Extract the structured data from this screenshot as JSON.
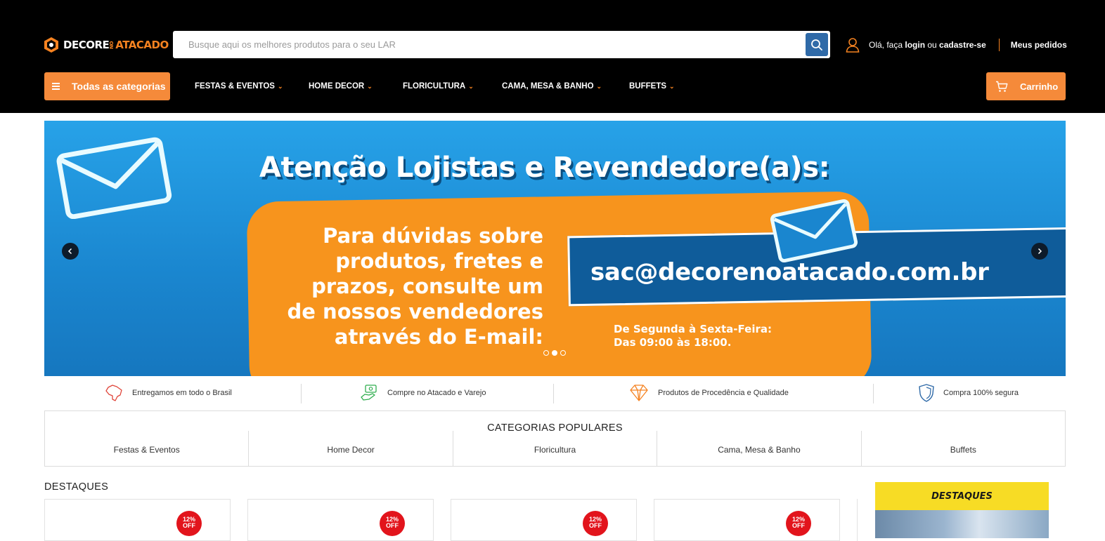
{
  "brand": {
    "logo_part1": "DECORE",
    "logo_part2": "NO",
    "logo_part3": "ATACADO",
    "accent_color": "#f58220",
    "header_bg": "#000000"
  },
  "search": {
    "placeholder": "Busque aqui os melhores produtos para o seu LAR",
    "icon": "search-icon"
  },
  "account": {
    "greeting": "Olá, faça ",
    "login": "login",
    "or": " ou ",
    "signup": "cadastre-se",
    "orders": "Meus pedidos",
    "icon": "user-icon"
  },
  "nav": {
    "all_categories": "Todas as categorias",
    "items": [
      {
        "label": "FESTAS & EVENTOS"
      },
      {
        "label": "HOME DECOR"
      },
      {
        "label": "FLORICULTURA"
      },
      {
        "label": "CAMA, MESA & BANHO"
      },
      {
        "label": "BUFFETS"
      }
    ],
    "cart": "Carrinho"
  },
  "banner": {
    "title": "Atenção Lojistas e Revendedore(a)s:",
    "body_lines": [
      "Para dúvidas sobre",
      "produtos, fretes e",
      "prazos, consulte um",
      "de nossos vendedores",
      "através do E-mail:"
    ],
    "email": "sac@decorenoatacado.com.br",
    "hours_line1": "De Segunda à Sexta-Feira:",
    "hours_line2": "Das 09:00 às 18:00.",
    "slides": 3,
    "active_slide": 2
  },
  "features": [
    {
      "text": "Entregamos em todo o Brasil",
      "icon": "brazil-map-icon"
    },
    {
      "text": "Compre no Atacado e Varejo",
      "icon": "money-hand-icon"
    },
    {
      "text": "Produtos de Procedência e Qualidade",
      "icon": "diamond-icon"
    },
    {
      "text": "Compra 100% segura",
      "icon": "shield-icon"
    }
  ],
  "popular": {
    "heading": "CATEGORIAS POPULARES",
    "items": [
      "Festas & Eventos",
      "Home Decor",
      "Floricultura",
      "Cama, Mesa & Banho",
      "Buffets"
    ]
  },
  "highlights": {
    "heading": "DESTAQUES",
    "badge": "12%\nOFF",
    "side_banner": "DESTAQUES"
  }
}
